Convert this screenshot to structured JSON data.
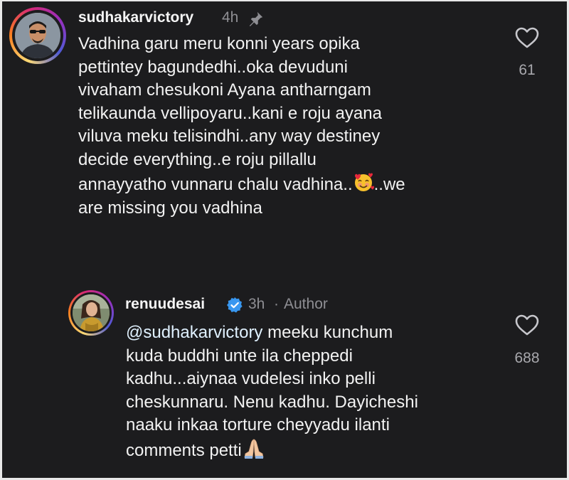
{
  "comment": {
    "username": "sudhakarvictory",
    "time": "4h",
    "lines": [
      "Vadhina garu meru konni years opika",
      "pettintey bagundedhi..oka devuduni",
      "vivaham chesukoni Ayana antharngam",
      "telikaunda vellipoyaru..kani e roju ayana",
      "viluva meku telisindhi..any way destiney",
      "decide everything..e roju pillallu",
      "annayyatho vunnaru chalu vadhina..",
      "..we",
      "are missing you vadhina"
    ],
    "emoji": "smiling-face-with-hearts",
    "likes": "61"
  },
  "reply": {
    "username": "renuudesai",
    "time": "3h",
    "separator": "·",
    "author_label": "Author",
    "mention": "@sudhakarvictory",
    "lines": [
      " meeku kunchum",
      "kuda buddhi unte ila cheppedi",
      "kadhu...aiynaa vudelesi inko pelli",
      "cheskunnaru. Nenu kadhu. Dayicheshi",
      "naaku inkaa torture cheyyadu ilanti",
      "comments petti"
    ],
    "emoji": "folded-hands",
    "likes": "688"
  },
  "colors": {
    "background": "#1c1c1e",
    "text": "#f2f2f2",
    "secondary": "#8e8e93",
    "verified": "#3897f0"
  }
}
